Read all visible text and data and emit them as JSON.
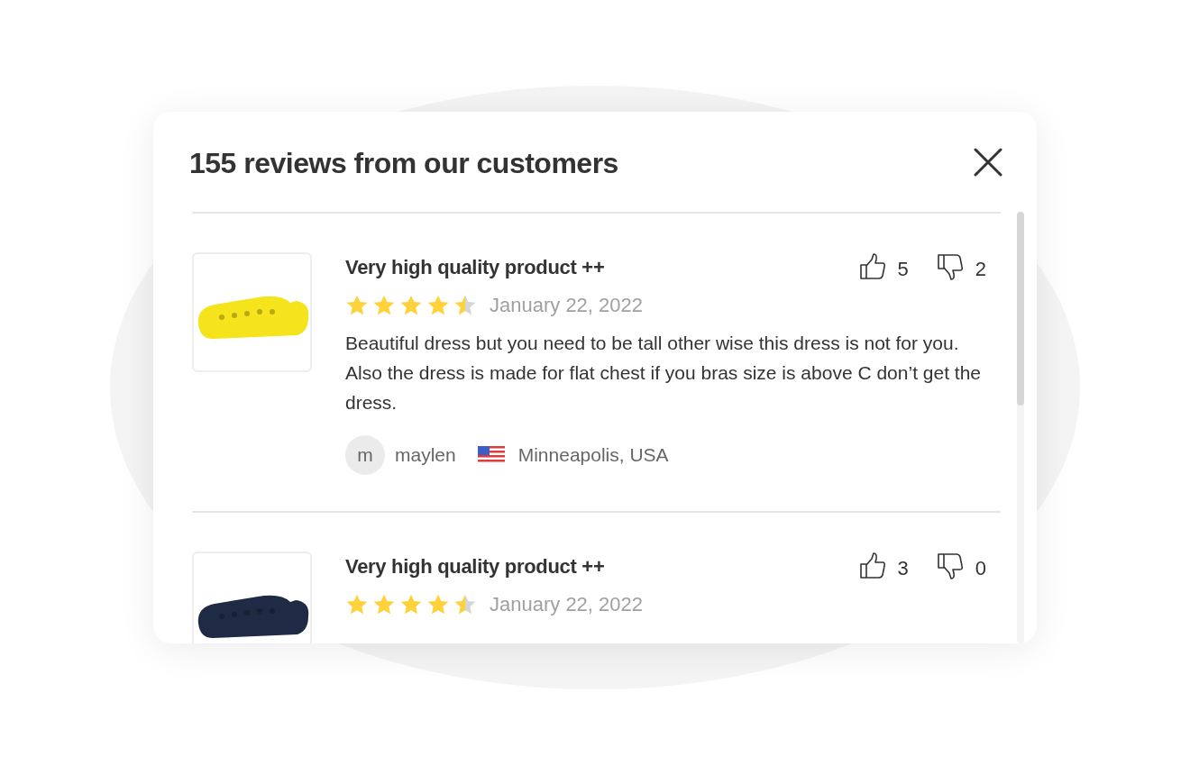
{
  "dialog": {
    "title": "155 reviews from our customers"
  },
  "reviews": [
    {
      "color": "#f5e31c",
      "title": "Very high quality product ++",
      "likes": "5",
      "dislikes": "2",
      "stars": 4.5,
      "date": "January 22, 2022",
      "text": "Beautiful dress but you need to be tall other wise this dress is not for you. Also the dress is made for flat chest if you bras size is above C don’t get the dress.",
      "avatar": "m",
      "author": "maylen",
      "location": "Minneapolis, USA"
    },
    {
      "color": "#1f2a44",
      "title": "Very high quality product ++",
      "likes": "3",
      "dislikes": "0",
      "stars": 4.5,
      "date": "January 22, 2022"
    }
  ]
}
